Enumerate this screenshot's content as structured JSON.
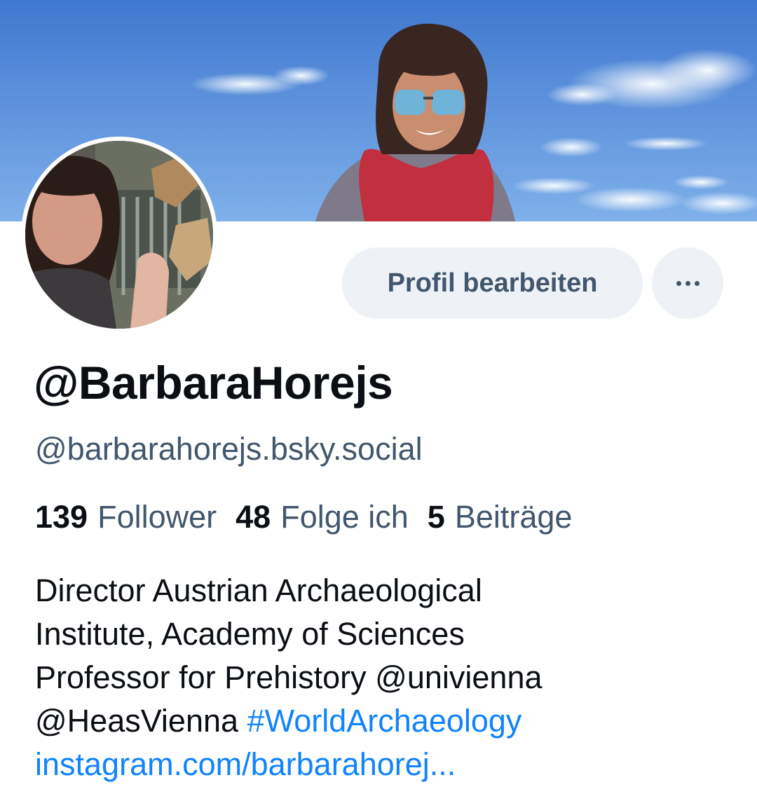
{
  "profile": {
    "display_name": "@BarbaraHorejs",
    "handle": "@barbarahorejs.bsky.social",
    "edit_button_label": "Profil bearbeiten",
    "more_button_icon": "more-horizontal-icon"
  },
  "stats": {
    "followers_count": "139",
    "followers_label": "Follower",
    "following_count": "48",
    "following_label": "Folge ich",
    "posts_count": "5",
    "posts_label": "Beiträge"
  },
  "bio": {
    "line1": "Director Austrian Archaeological",
    "line2": "Institute, Academy of Sciences",
    "line3": "Professor for Prehistory @univienna",
    "line4_text": "@HeasVienna ",
    "hashtag": "#WorldArchaeology",
    "link": "instagram.com/barbarahorej..."
  },
  "colors": {
    "accent": "#1083fe",
    "muted_text": "#42566e",
    "button_bg": "#eef2f6",
    "sky": "#4f86d6"
  }
}
